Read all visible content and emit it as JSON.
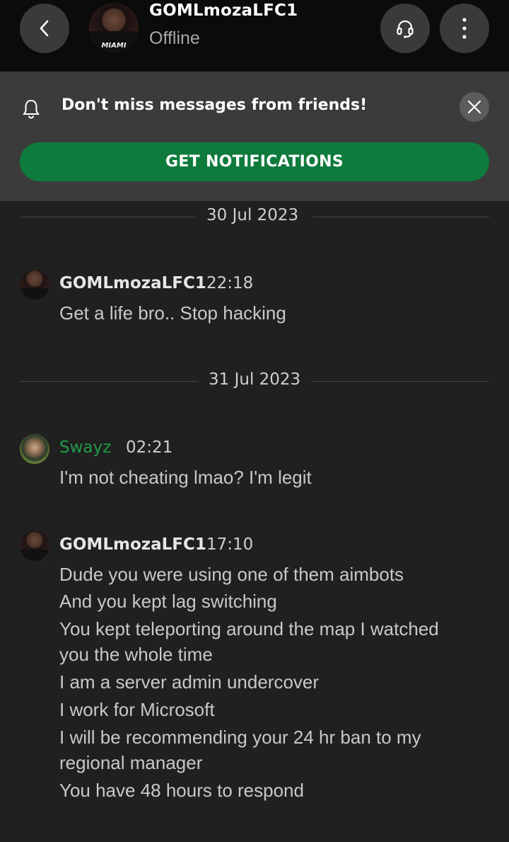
{
  "header": {
    "contact_name": "GOMLmozaLFC1",
    "status": "Offline",
    "avatar_jersey_text": "MIAMI"
  },
  "banner": {
    "text": "Don't miss messages from friends!",
    "button_label": "GET NOTIFICATIONS",
    "button_color": "#0e7a3c"
  },
  "conversation": {
    "date_1": "30 Jul 2023",
    "date_2": "31 Jul 2023",
    "messages": [
      {
        "sender": "GOMLmozaLFC1",
        "time": "22:18",
        "lines": [
          "Get a life bro.. Stop hacking"
        ]
      },
      {
        "sender": "Swayz",
        "time": "02:21",
        "lines": [
          "I'm not cheating lmao? I'm legit"
        ]
      },
      {
        "sender": "GOMLmozaLFC1",
        "time": "17:10",
        "lines": [
          "Dude you were using one of them aimbots",
          "And you kept lag switching",
          "You kept teleporting around the map I watched",
          "you the whole time",
          "I am a server admin undercover",
          "I work for Microsoft",
          "I will be recommending your 24 hr ban to my",
          "regional manager",
          "You have 48 hours to respond"
        ]
      }
    ]
  },
  "colors": {
    "self_name": "#1f9a4a",
    "background": "#202020",
    "header_background": "#0b0b0b",
    "banner_background": "#3b3b3b"
  },
  "icons": [
    "back-arrow-icon",
    "headset-icon",
    "more-vertical-icon",
    "bell-icon",
    "close-icon"
  ]
}
